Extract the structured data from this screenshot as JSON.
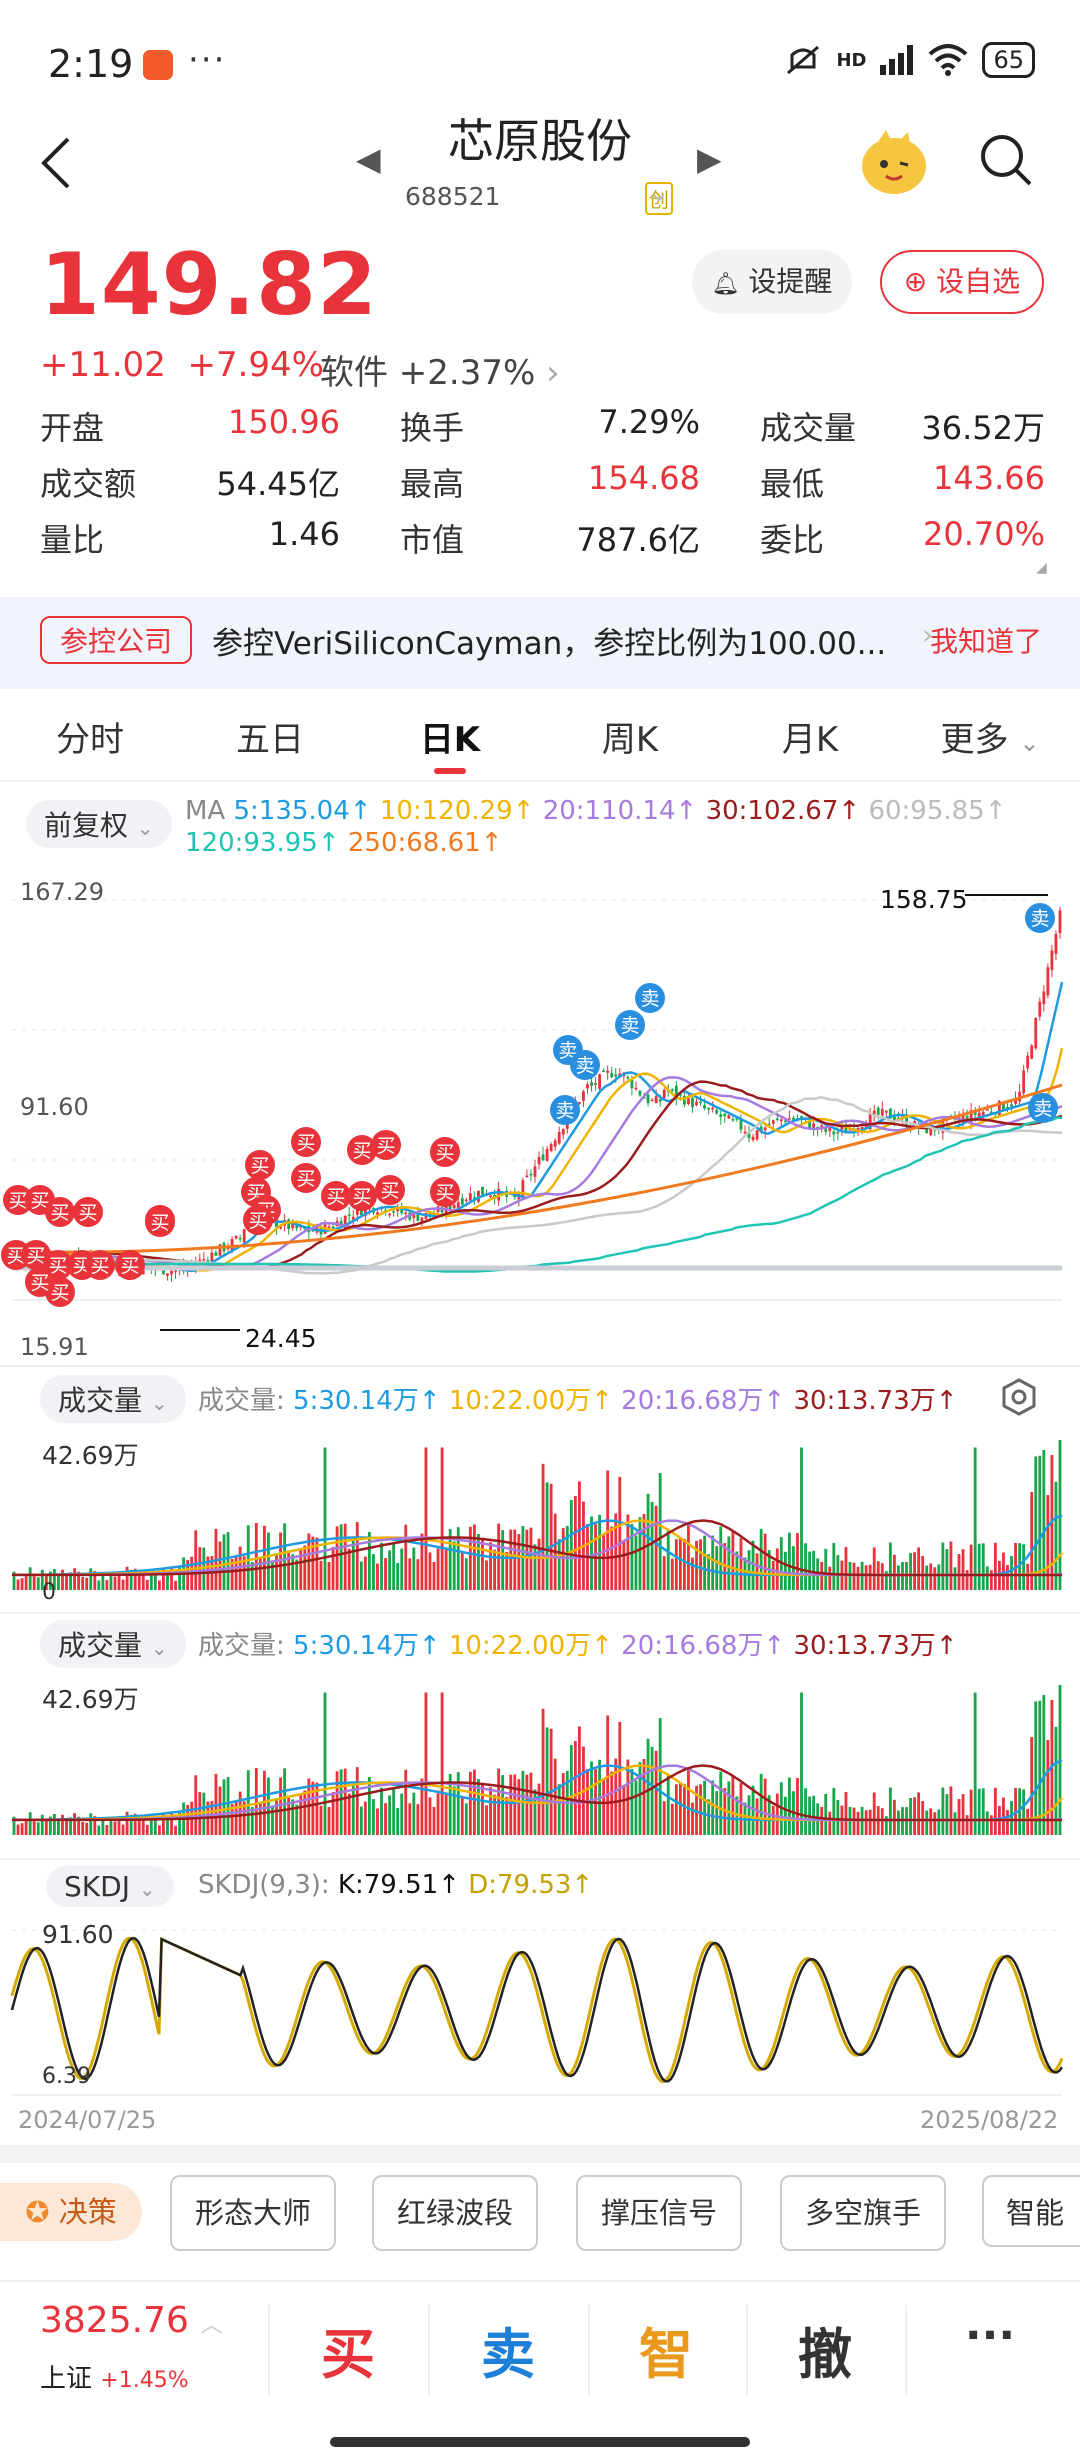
{
  "status": {
    "time": "2:19",
    "dots": "···",
    "battery": "65",
    "net": "HD"
  },
  "header": {
    "title": "芯原股份",
    "code": "688521"
  },
  "quote": {
    "price": "149.82",
    "change": "+11.02",
    "change_pct": "+7.94%",
    "sector": "软件 +2.37%",
    "alert_label": "设提醒",
    "watch_label": "设自选",
    "stats": [
      [
        {
          "label": "开盘",
          "value": "150.96",
          "color": "red"
        },
        {
          "label": "换手",
          "value": "7.29%",
          "color": "black"
        },
        {
          "label": "成交量",
          "value": "36.52万",
          "color": "black"
        }
      ],
      [
        {
          "label": "成交额",
          "value": "54.45亿",
          "color": "black"
        },
        {
          "label": "最高",
          "value": "154.68",
          "color": "red"
        },
        {
          "label": "最低",
          "value": "143.66",
          "color": "red"
        }
      ],
      [
        {
          "label": "量比",
          "value": "1.46",
          "color": "black"
        },
        {
          "label": "市值",
          "value": "787.6亿",
          "color": "black"
        },
        {
          "label": "委比",
          "value": "20.70%",
          "color": "red"
        }
      ]
    ]
  },
  "notice": {
    "tag": "参控公司",
    "text": "参控VeriSiliconCayman，参控比例为100.00...",
    "ok": "我知道了"
  },
  "tabs": [
    "分时",
    "五日",
    "日K",
    "周K",
    "月K",
    "更多"
  ],
  "kline": {
    "adjust": "前复权",
    "ma_prefix": "MA",
    "ma": [
      {
        "text": "5:135.04↑",
        "color": "#1e9be0"
      },
      {
        "text": "10:120.29↑",
        "color": "#f0b400"
      },
      {
        "text": "20:110.14↑",
        "color": "#a57be0"
      },
      {
        "text": "30:102.67↑",
        "color": "#9b1c1c"
      },
      {
        "text": "60:95.85↑",
        "color": "#bbbbbb"
      },
      {
        "text": "120:93.95↑",
        "color": "#1fc4b4"
      },
      {
        "text": "250:68.61↑",
        "color": "#f07a20"
      }
    ],
    "y_top": "167.29",
    "y_mid": "91.60",
    "y_bot": "15.91",
    "high_label": "158.75",
    "low_label": "24.45",
    "buy": "买",
    "sell": "卖"
  },
  "vol1": {
    "menu": "成交量",
    "title": "成交量:",
    "v5": "5:30.14万↑",
    "v10": "10:22.00万↑",
    "v20": "20:16.68万↑",
    "v30": "30:13.73万↑",
    "ymax": "42.69万",
    "y0": "0"
  },
  "vol2": {
    "menu": "成交量",
    "title": "成交量:",
    "v5": "5:30.14万↑",
    "v10": "10:22.00万↑",
    "v20": "20:16.68万↑",
    "v30": "30:13.73万↑",
    "ymax": "42.69万"
  },
  "skdj": {
    "menu": "SKDJ",
    "title": "SKDJ(9,3):",
    "k": "K:79.51↑",
    "d": "D:79.53↑",
    "ymax": "91.60",
    "ymin": "6.39",
    "date_start": "2024/07/25",
    "date_end": "2025/08/22"
  },
  "tools": {
    "decide": "决策",
    "items": [
      "形态大师",
      "红绿波段",
      "撑压信号",
      "多空旗手",
      "智能"
    ]
  },
  "bottom": {
    "index_value": "3825.76",
    "index_name": "上证",
    "index_change": "+1.45%",
    "buy": "买",
    "sell": "卖",
    "smart": "智",
    "cancel": "撤",
    "more": "···"
  }
}
